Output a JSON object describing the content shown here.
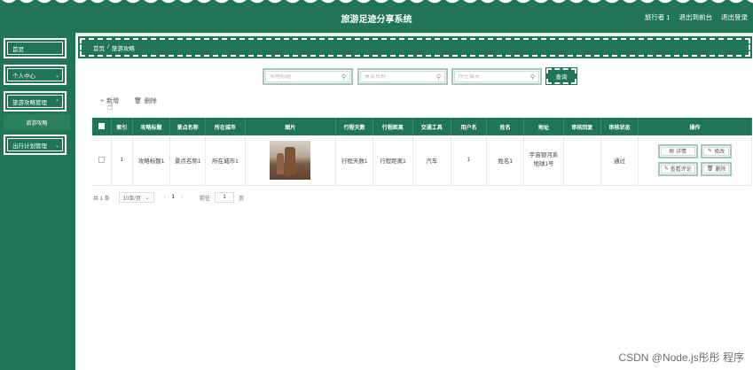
{
  "header": {
    "title": "旅游足迹分享系统",
    "user": "旅行者 1",
    "back_front": "退出到前台",
    "logout": "退出登录"
  },
  "sidebar": {
    "items": [
      {
        "label": "首页"
      },
      {
        "label": "个人中心"
      },
      {
        "label": "旅游攻略管理"
      },
      {
        "label": "出行计划管理"
      }
    ],
    "sub_item": "旅游攻略"
  },
  "breadcrumb": {
    "home": "首页",
    "sep": "/",
    "current": "旅游攻略"
  },
  "search": {
    "title_placeholder": "攻略标题",
    "spot_placeholder": "景点名称",
    "city_placeholder": "所在城市",
    "button": "查询"
  },
  "toolbar": {
    "add": "新增",
    "delete": "删除"
  },
  "table": {
    "headers": [
      "",
      "索引",
      "攻略标题",
      "景点名称",
      "所在城市",
      "图片",
      "行程天数",
      "行程距离",
      "交通工具",
      "用户名",
      "姓名",
      "地址",
      "审核回复",
      "审核状态",
      "操作"
    ],
    "rows": [
      {
        "index": "1",
        "title": "攻略标题1",
        "spot": "景点名称1",
        "city": "所在城市1",
        "days": "行程天数1",
        "distance": "行程距离1",
        "transport": "汽车",
        "username": "1",
        "name": "姓名1",
        "address": "宇宙银河系地球1号",
        "reply": "",
        "status": "通过"
      }
    ],
    "actions": {
      "detail": "详情",
      "edit": "修改",
      "review": "查看评论",
      "delete": "删除"
    }
  },
  "pagination": {
    "total": "共 1 条",
    "page_size": "10条/页",
    "current_page": "1",
    "goto_label": "前往",
    "goto_value": "1",
    "unit": "页"
  },
  "watermark": "CSDN @Node.js彤彤 程序"
}
